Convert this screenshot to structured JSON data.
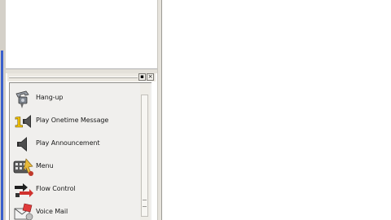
{
  "palette": {
    "header": {
      "pin_glyph": "▪",
      "close_glyph": "×"
    },
    "items": [
      {
        "label": "Hang-up",
        "icon": "hang-up-phone-icon"
      },
      {
        "label": "Play Onetime Message",
        "icon": "play-onetime-message-icon"
      },
      {
        "label": "Play Announcement",
        "icon": "speaker-icon"
      },
      {
        "label": "Menu",
        "icon": "keypad-menu-icon"
      },
      {
        "label": "Flow Control",
        "icon": "flow-control-icon"
      },
      {
        "label": "Voice Mail",
        "icon": "voice-mail-icon"
      }
    ]
  }
}
